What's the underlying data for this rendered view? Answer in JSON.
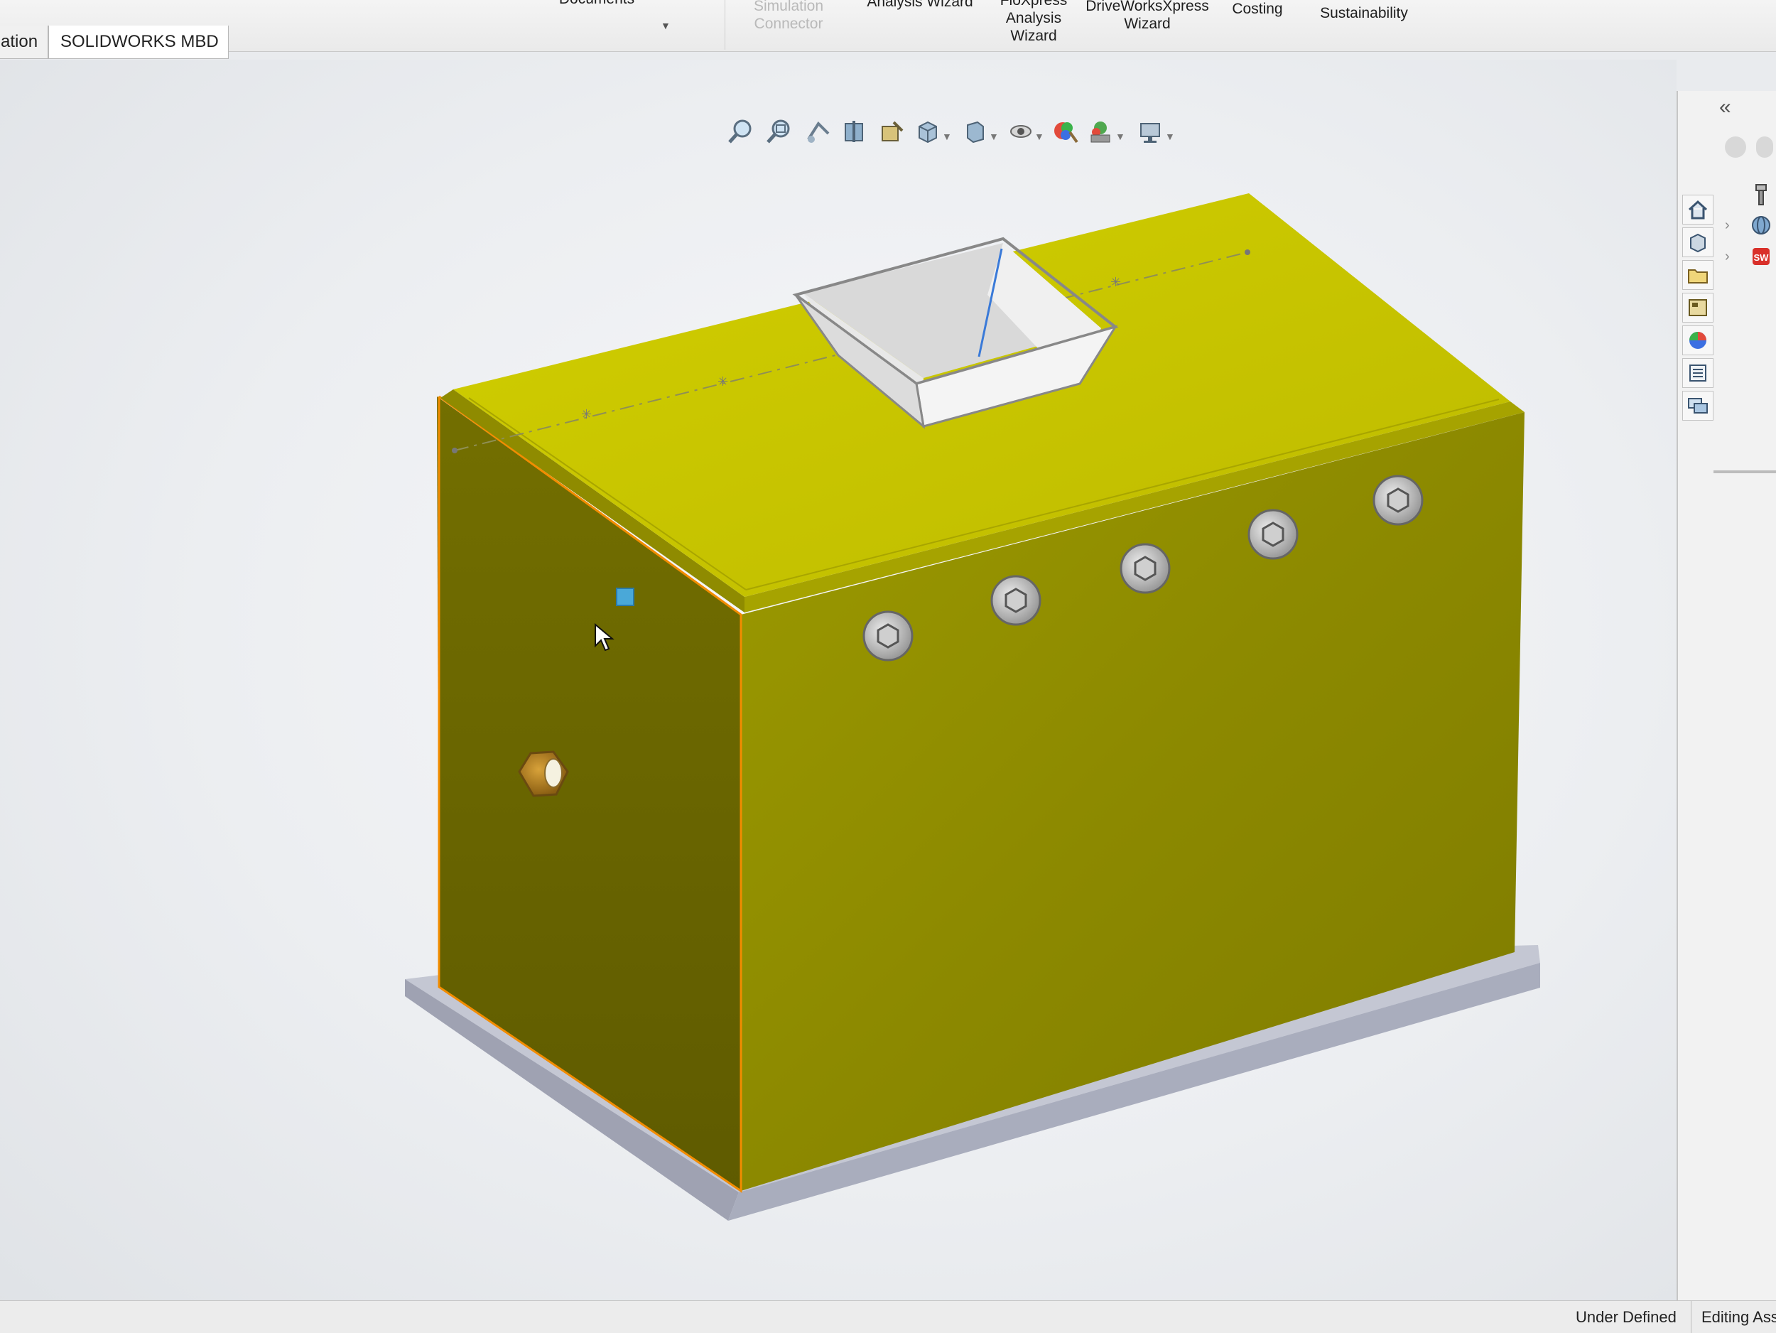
{
  "ribbon": {
    "items": [
      {
        "id": "documents",
        "line1": "Documents",
        "line2": "",
        "line3": "",
        "disabled": false
      },
      {
        "id": "simulation",
        "line1": "Simulation",
        "line2": "Connector",
        "line3": "",
        "disabled": true
      },
      {
        "id": "analysis-wizard",
        "line1": "",
        "line2": "Analysis Wizard",
        "line3": "",
        "disabled": false
      },
      {
        "id": "flowxpress",
        "line1": "FloXpress",
        "line2": "Analysis",
        "line3": "Wizard",
        "disabled": false
      },
      {
        "id": "driveworks",
        "line1": "DriveWorksXpress",
        "line2": "Wizard",
        "line3": "",
        "disabled": false
      },
      {
        "id": "costing",
        "line1": "Costing",
        "line2": "",
        "line3": "",
        "disabled": false
      },
      {
        "id": "sustainability",
        "line1": "Sustainability",
        "line2": "",
        "line3": "",
        "disabled": false
      }
    ]
  },
  "tabs": [
    {
      "label": "ation",
      "active": false
    },
    {
      "label": "SOLIDWORKS MBD",
      "active": true
    }
  ],
  "heads_up_toolbar": {
    "icons": [
      "zoom-to-fit-icon",
      "zoom-to-area-icon",
      "previous-view-icon",
      "section-view-icon",
      "dynamic-annotation-icon",
      "view-orientation-icon",
      "display-style-icon",
      "hide-show-items-icon",
      "edit-appearance-icon",
      "apply-scene-icon",
      "view-settings-icon"
    ]
  },
  "taskpane": {
    "collapse_glyph": "«",
    "tabs": [
      "home-icon",
      "parts-library-icon",
      "file-explorer-icon",
      "view-palette-icon",
      "appearances-icon",
      "custom-properties-icon",
      "forum-icon"
    ],
    "tree": [
      "toolbox-icon",
      "3d-content-icon",
      "solidworks-content-icon"
    ]
  },
  "colors": {
    "body_front": "#8f8c00",
    "body_side": "#6b6700",
    "lid_top": "#c7c400",
    "base_plate": "#b9bdca",
    "hopper": "#ececec",
    "edge_highlight": "#f28c00",
    "selection_square": "#4aa8d8"
  },
  "status": {
    "defined": "Under Defined",
    "editing": "Editing Asser"
  }
}
